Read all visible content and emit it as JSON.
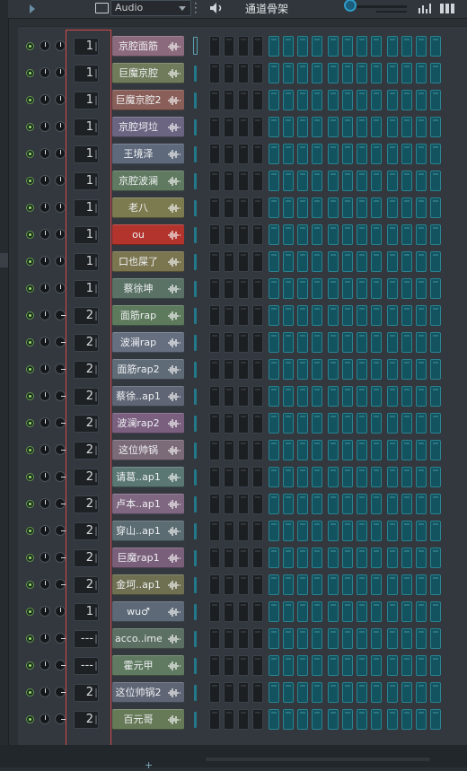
{
  "toolbar": {
    "pattern_select": "Audio",
    "title": "通道骨架"
  },
  "channels": [
    {
      "route": "1",
      "name": "京腔面筋",
      "color": "#8c6a7d"
    },
    {
      "route": "1",
      "name": "巨魔京腔",
      "color": "#6f7b5b"
    },
    {
      "route": "1",
      "name": "巨魔京腔2",
      "color": "#8a5f59"
    },
    {
      "route": "1",
      "name": "京腔坷垃",
      "color": "#6c6582"
    },
    {
      "route": "1",
      "name": "王境泽",
      "color": "#5e6a7c"
    },
    {
      "route": "1",
      "name": "京腔波澜",
      "color": "#5f7a60"
    },
    {
      "route": "1",
      "name": "老八",
      "color": "#7c7a4f"
    },
    {
      "route": "1",
      "name": "ou",
      "color": "#b3332d"
    },
    {
      "route": "1",
      "name": "口也屎了",
      "color": "#7b7550"
    },
    {
      "route": "1",
      "name": "蔡徐坤",
      "color": "#5a7265"
    },
    {
      "route": "2",
      "name": "面筋rap",
      "color": "#5d7a5d"
    },
    {
      "route": "2",
      "name": "波澜rap",
      "color": "#666f80"
    },
    {
      "route": "2",
      "name": "面筋rap2",
      "color": "#606b78"
    },
    {
      "route": "2",
      "name": "蔡徐..ap1",
      "color": "#5f6575"
    },
    {
      "route": "2",
      "name": "波澜rap2",
      "color": "#7a5f7f"
    },
    {
      "route": "2",
      "name": "这位帅锅",
      "color": "#7b6a78"
    },
    {
      "route": "2",
      "name": "请葛..ap1",
      "color": "#5a7773"
    },
    {
      "route": "2",
      "name": "卢本..ap1",
      "color": "#7f6781"
    },
    {
      "route": "2",
      "name": "穿山..ap1",
      "color": "#5b6c72"
    },
    {
      "route": "2",
      "name": "巨魔rap1",
      "color": "#7a5f7b"
    },
    {
      "route": "2",
      "name": "金坷..ap1",
      "color": "#6e7051"
    },
    {
      "route": "1",
      "name": "wu♂",
      "color": "#5d6977"
    },
    {
      "route": "---",
      "name": "acco..iment",
      "color": "#5c6f63"
    },
    {
      "route": "---",
      "name": "霍元甲",
      "color": "#5f7a60"
    },
    {
      "route": "2",
      "name": "这位帅锅2",
      "color": "#5f6575"
    },
    {
      "route": "2",
      "name": "百元哥",
      "color": "#677a58"
    }
  ]
}
